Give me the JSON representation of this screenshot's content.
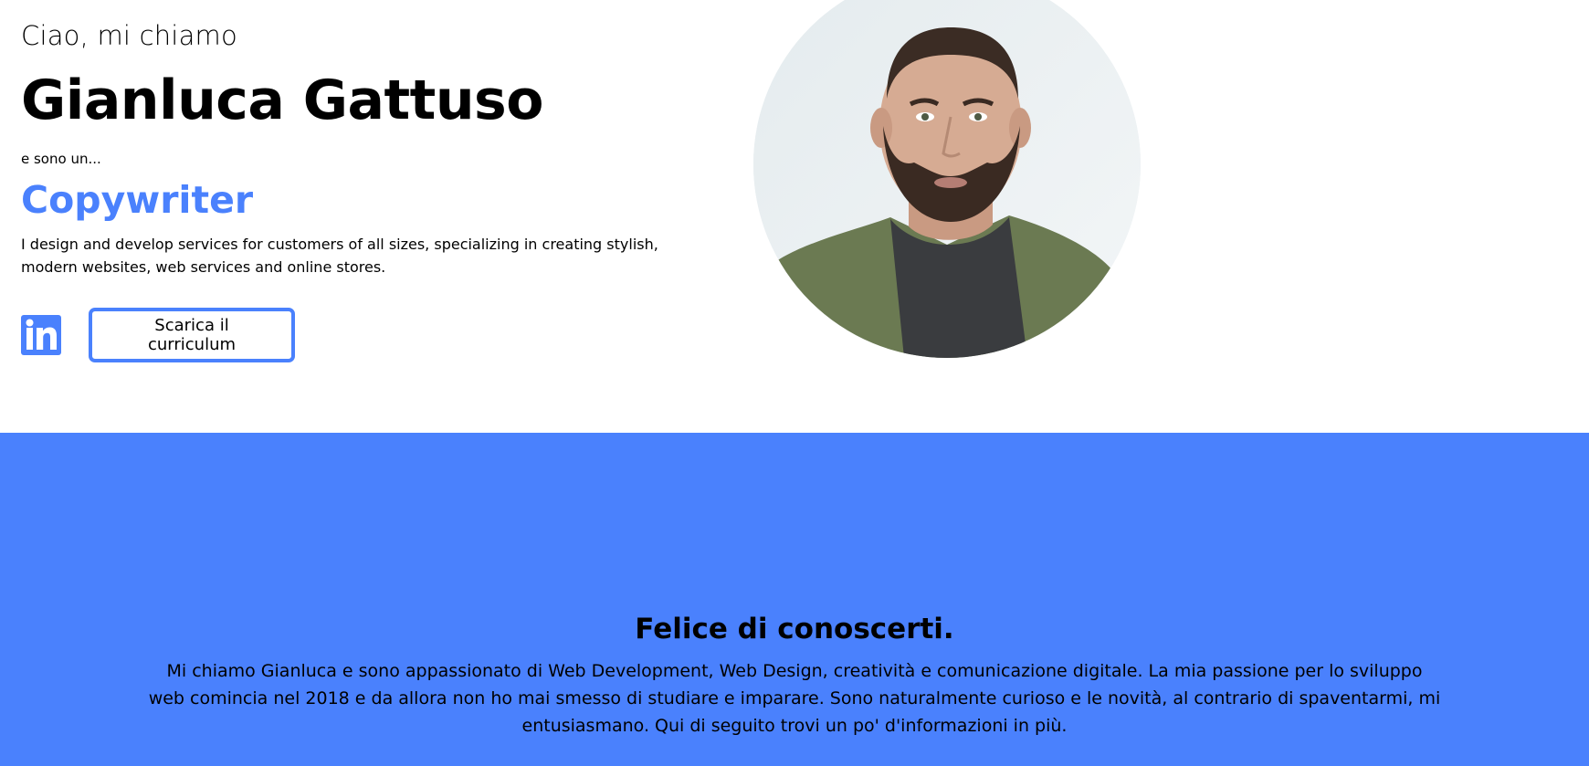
{
  "hero": {
    "greeting": "Ciao, mi chiamo",
    "name": "Gianluca Gattuso",
    "intro": "e sono un...",
    "role": "Copywriter",
    "description": "I design and develop services for customers of all sizes, specializing in creating stylish, modern websites, web services and online stores.",
    "linkedin_icon": "linkedin-icon",
    "cv_button_label": "Scarica il curriculum"
  },
  "about": {
    "title": "Felice di conoscerti.",
    "text": "Mi chiamo Gianluca e sono appassionato di Web Development, Web Design, creatività e comunicazione digitale. La mia passione per lo sviluppo web comincia nel 2018 e da allora non ho mai smesso di studiare e imparare. Sono naturalmente curioso e le novità, al contrario di spaventarmi, mi entusiasmano. Qui di seguito trovi un po' d'informazioni in più."
  },
  "colors": {
    "accent": "#4a81fd",
    "text": "#000000",
    "background": "#ffffff"
  }
}
